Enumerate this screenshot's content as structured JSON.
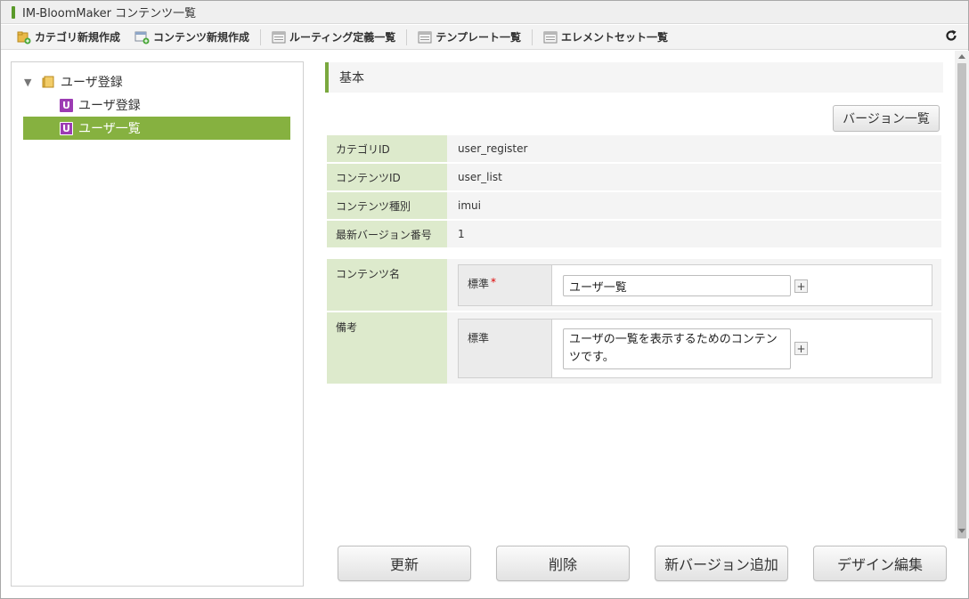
{
  "window": {
    "title": "IM-BloomMaker コンテンツ一覧"
  },
  "toolbar": {
    "items": [
      {
        "label": "カテゴリ新規作成",
        "icon": "folder-add-icon"
      },
      {
        "label": "コンテンツ新規作成",
        "icon": "content-add-icon"
      },
      {
        "label": "ルーティング定義一覧",
        "icon": "list-window-icon"
      },
      {
        "label": "テンプレート一覧",
        "icon": "list-window-icon"
      },
      {
        "label": "エレメントセット一覧",
        "icon": "list-window-icon"
      }
    ],
    "refresh_icon": "refresh-icon"
  },
  "tree": {
    "category": {
      "label": "ユーザ登録",
      "icon": "folder-icon",
      "expanded": true
    },
    "items": [
      {
        "label": "ユーザ登録",
        "badge": "U",
        "selected": false
      },
      {
        "label": "ユーザ一覧",
        "badge": "U",
        "selected": true
      }
    ]
  },
  "section": {
    "title": "基本"
  },
  "version_button": "バージョン一覧",
  "info": [
    {
      "label": "カテゴリID",
      "value": "user_register"
    },
    {
      "label": "コンテンツID",
      "value": "user_list"
    },
    {
      "label": "コンテンツ種別",
      "value": "imui"
    },
    {
      "label": "最新バージョン番号",
      "value": "1"
    }
  ],
  "fields": {
    "content_name": {
      "label": "コンテンツ名",
      "sub_label": "標準",
      "required_mark": "*",
      "value": "ユーザ一覧"
    },
    "remarks": {
      "label": "備考",
      "sub_label": "標準",
      "value": "ユーザの一覧を表示するためのコンテンツです。"
    },
    "plus": "+"
  },
  "buttons": {
    "update": "更新",
    "delete": "削除",
    "new_version": "新バージョン追加",
    "edit_design": "デザイン編集"
  },
  "colors": {
    "accent_green": "#86b140",
    "label_bg": "#ddeacc",
    "badge_purple": "#9c3bb3"
  }
}
